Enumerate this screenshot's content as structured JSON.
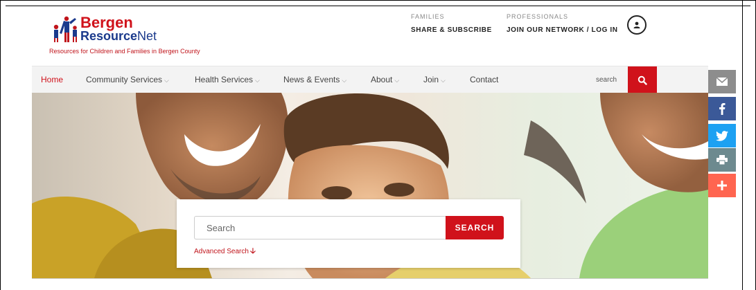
{
  "brand": {
    "name_line1": "Bergen",
    "name_line2_bold": "Resource",
    "name_line2_rest": "Net",
    "tagline": "Resources for Children and Families in Bergen County"
  },
  "header": {
    "families_label": "FAMILIES",
    "families_link": "SHARE & SUBSCRIBE",
    "professionals_label": "PROFESSIONALS",
    "professionals_link": "JOIN OUR NETWORK / LOG IN"
  },
  "nav": {
    "items": [
      {
        "label": "Home",
        "active": true,
        "dropdown": false
      },
      {
        "label": "Community Services",
        "active": false,
        "dropdown": true
      },
      {
        "label": "Health Services",
        "active": false,
        "dropdown": true
      },
      {
        "label": "News & Events",
        "active": false,
        "dropdown": true
      },
      {
        "label": "About",
        "active": false,
        "dropdown": true
      },
      {
        "label": "Join",
        "active": false,
        "dropdown": true
      },
      {
        "label": "Contact",
        "active": false,
        "dropdown": false
      }
    ],
    "search_label": "search",
    "chevron": "⌵"
  },
  "search": {
    "placeholder": "Search",
    "button_label": "SEARCH",
    "advanced_label": "Advanced Search",
    "advanced_arrow": "🡣"
  },
  "share": [
    {
      "icon": "email-icon",
      "color": "#8d8d8d"
    },
    {
      "icon": "facebook-icon",
      "color": "#3b5998"
    },
    {
      "icon": "twitter-icon",
      "color": "#1da1f2"
    },
    {
      "icon": "print-icon",
      "color": "#6d8a8f"
    },
    {
      "icon": "more-icon",
      "color": "#ff6550"
    }
  ],
  "colors": {
    "accent": "#d0121b",
    "brand_blue": "#1b3a8c"
  }
}
